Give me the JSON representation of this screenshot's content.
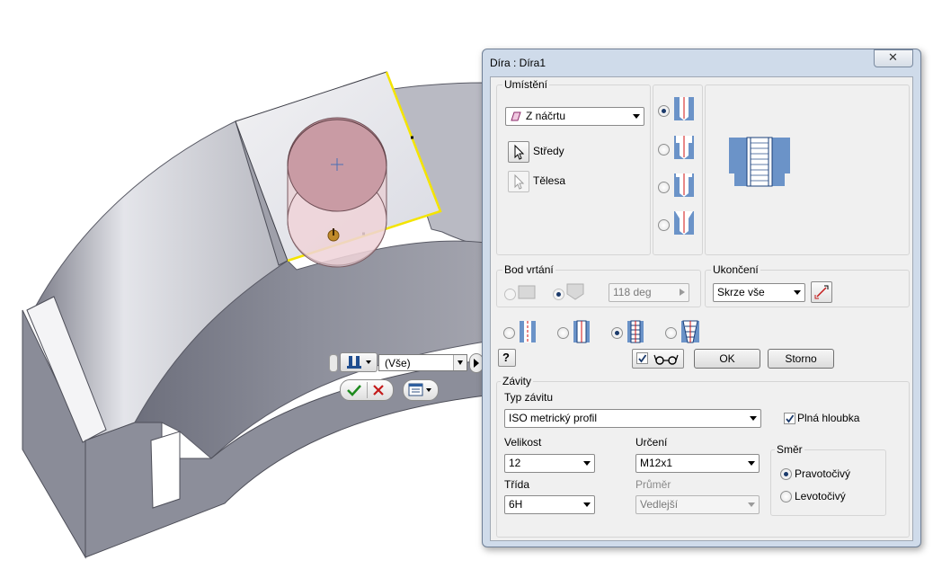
{
  "dialog": {
    "title": "Díra : Díra1",
    "close_symbol": "✕",
    "placement": {
      "group_label": "Umístění",
      "mode_value": "Z náčrtu",
      "centers_label": "Středy",
      "solids_label": "Tělesa"
    },
    "hole_types": {
      "selected_index": 0,
      "options": [
        "simple-hole-icon",
        "counterbore-hole-icon",
        "spotface-hole-icon",
        "countersink-hole-icon"
      ]
    },
    "drill_point": {
      "group_label": "Bod vrtání",
      "angle_value": "118 deg"
    },
    "termination": {
      "group_label": "Ukončení",
      "value": "Skrze vše"
    },
    "hole_kinds": {
      "selected_index": 2,
      "options": [
        "simple-drill-icon",
        "clearance-icon",
        "tapped-icon",
        "taper-tapped-icon"
      ]
    },
    "help_symbol": "?",
    "ok_label": "OK",
    "cancel_label": "Storno",
    "threads": {
      "group_label": "Závity",
      "type_label": "Typ závitu",
      "type_value": "ISO metrický profil",
      "full_depth_label": "Plná hloubka",
      "full_depth_checked": true,
      "size_label": "Velikost",
      "size_value": "12",
      "designation_label": "Určení",
      "designation_value": "M12x1",
      "class_label": "Třída",
      "class_value": "6H",
      "diameter_label": "Průměr",
      "diameter_value": "Vedlejší",
      "direction_label": "Směr",
      "right_hand_label": "Pravotočivý",
      "left_hand_label": "Levotočivý",
      "right_hand_selected": true
    }
  },
  "mini_toolbar": {
    "selection_value": "(Vše)"
  },
  "colors": {
    "dialog_frame": "#cfdbea",
    "model_face": "#e8e9ee",
    "hole_preview": "#c79aa2",
    "highlight_edge": "#f4e400"
  }
}
